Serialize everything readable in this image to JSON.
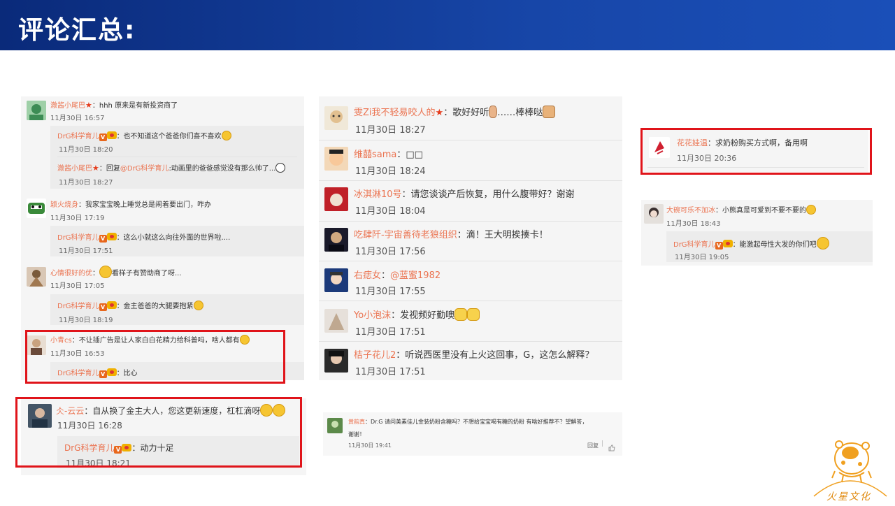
{
  "title": "评论汇总:",
  "panel1": {
    "c1": {
      "user": "澈酱小尾巴",
      "text": "：hhh 原来是有新投资商了",
      "time": "11月30日 16:57"
    },
    "c1r1": {
      "user": "DrG科学育儿",
      "text": "：也不知道这个爸爸你们喜不喜欢",
      "time": "11月30日 18:20"
    },
    "c1r2": {
      "user": "澈酱小尾巴",
      "text": "：回复",
      "mention": "@DrG科学育儿",
      "text2": ":动画里的爸爸感觉没有那么帅了...",
      "time": "11月30日 18:27"
    },
    "c2": {
      "user": "颖火烧身",
      "text": "：我家宝宝晚上睡觉总是闹着要出门，咋办",
      "time": "11月30日 17:19"
    },
    "c2r1": {
      "user": "DrG科学育儿",
      "text": "：这么小就这么向往外面的世界啦....",
      "time": "11月30日 17:51"
    },
    "c3": {
      "user": "心情很好的优",
      "text": "看样子有赞助商了呀...",
      "time": "11月30日 17:05"
    },
    "c3r1": {
      "user": "DrG科学育儿",
      "text": "：金主爸爸的大腿要抱紧",
      "time": "11月30日 18:19"
    },
    "c4": {
      "user": "小青cs",
      "text": "：不让插广告是让人家白白花精力给科普吗，啥人都有",
      "time": "11月30日 16:53"
    },
    "c4r1": {
      "user": "DrG科学育儿",
      "text": "：比心"
    }
  },
  "panel2": {
    "c1": {
      "user": "仌-云云",
      "text": "：自从换了金主大人，您这更新速度，杠杠滴呀",
      "time": "11月30日 16:28"
    },
    "c1r1": {
      "user": "DrG科学育儿",
      "text": "：动力十足",
      "time": "11月30日 18:21"
    }
  },
  "panel3": [
    {
      "user": "雯Zi我不轻易咬人的",
      "text": "：歌好好听",
      "text2": "……棒棒哒",
      "time": "11月30日 18:27"
    },
    {
      "user": "维囍sama",
      "text": "：□□",
      "time": "11月30日 18:24"
    },
    {
      "user": "冰淇淋10号",
      "text": "：请您谈谈产后恢复，用什么腹带好？谢谢",
      "time": "11月30日 18:04"
    },
    {
      "user": "吃肆阡-宇宙善待老狼组织",
      "text": "：滴！王大明挨揍卡！",
      "time": "11月30日 17:56"
    },
    {
      "user": "右痣女",
      "text": "：",
      "mention": "@蓝蜜1982",
      "time": "11月30日 17:55"
    },
    {
      "user": "Yo小泡沫",
      "text": "：发视频好勤噢",
      "time": "11月30日 17:51"
    },
    {
      "user": "桔子花儿2",
      "text": "：听说西医里没有上火这回事，G，这怎么解释？",
      "time": "11月30日 17:51"
    }
  ],
  "panel4": {
    "user": "黄韵真",
    "text": "：Dr.G 请问美素佳儿金装奶粉含糖吗？不想给宝宝喝有糖的奶粉 有啥好推荐不？望解答，",
    "text2": "谢谢！",
    "time": "11月30日 19:41",
    "reply": "回复"
  },
  "panel5": {
    "user": "花花娃温",
    "text": "：求奶粉购买方式啊，备用啊",
    "time": "11月30日 20:36"
  },
  "panel6": {
    "c1": {
      "user": "大碗可乐不加冰",
      "text": "：小熊真是可爱到不要不要的",
      "time": "11月30日 18:43"
    },
    "c1r1": {
      "user": "DrG科学育儿",
      "text": "：能激起母性大发的你们吧",
      "time": "11月30日 19:05"
    }
  },
  "badges": {
    "verified": "V"
  },
  "logo_text": "火星文化",
  "colors": {
    "banner": "#1746a8",
    "username": "#eb7350",
    "highlight": "#e0141a"
  }
}
